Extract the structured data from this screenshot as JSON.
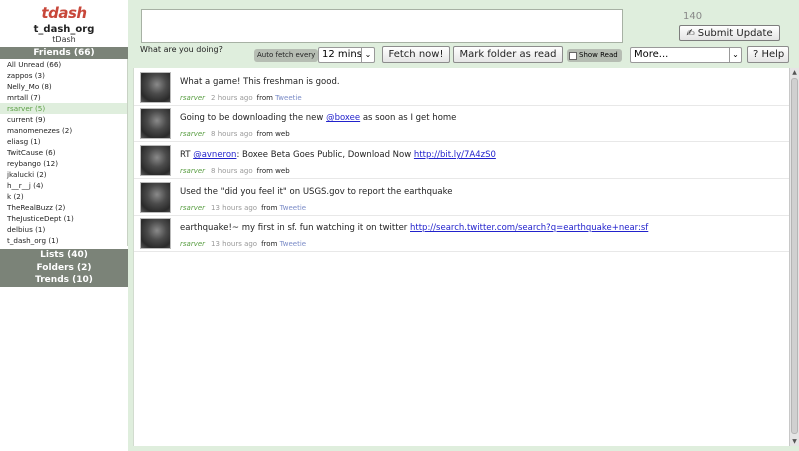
{
  "logo": {
    "t": "t",
    "rest": "dash"
  },
  "user": {
    "username": "t_dash_org",
    "label": "tDash"
  },
  "sidebar": {
    "friends_head": "Friends (66)",
    "friends": [
      {
        "label": "All Unread (66)"
      },
      {
        "label": "zappos (3)"
      },
      {
        "label": "Nelly_Mo (8)"
      },
      {
        "label": "mrtall (7)"
      },
      {
        "label": "rsarver (5)",
        "active": true
      },
      {
        "label": "current (9)"
      },
      {
        "label": "manomenezes (2)"
      },
      {
        "label": "eliasg (1)"
      },
      {
        "label": "TwitCause (6)"
      },
      {
        "label": "reybango (12)"
      },
      {
        "label": "jkalucki (2)"
      },
      {
        "label": "h__r__j (4)"
      },
      {
        "label": "k (2)"
      },
      {
        "label": "TheRealBuzz (2)"
      },
      {
        "label": "TheJusticeDept (1)"
      },
      {
        "label": "delbius (1)"
      },
      {
        "label": "t_dash_org (1)"
      }
    ],
    "lists_head": "Lists (40)",
    "folders_head": "Folders (2)",
    "trends_head": "Trends (10)"
  },
  "compose": {
    "value": "",
    "char_count": "140",
    "submit_label": "Submit Update",
    "prompt": "What are you doing?"
  },
  "toolbar": {
    "autofetch_label": "Auto fetch every",
    "interval_value": "12 mins",
    "fetch_label": "Fetch now!",
    "markread_label": "Mark folder as read",
    "showread_label": "Show Read",
    "more_value": "More...",
    "help_label": "? Help"
  },
  "tweets": [
    {
      "text_before": "What a game! This freshman is good.",
      "mention": "",
      "text_after": "",
      "link": "",
      "author": "rsarver",
      "time": "2 hours ago",
      "from": "from",
      "source": "Tweetie"
    },
    {
      "text_before": "Going to be downloading the new ",
      "mention": "@boxee",
      "text_after": " as soon as I get home",
      "link": "",
      "author": "rsarver",
      "time": "8 hours ago",
      "from": "from",
      "source": "web"
    },
    {
      "text_before": "RT ",
      "mention": "@avneron",
      "text_after": ": Boxee Beta Goes Public, Download Now ",
      "link": "http://bit.ly/7A4zS0",
      "author": "rsarver",
      "time": "8 hours ago",
      "from": "from",
      "source": "web"
    },
    {
      "text_before": "Used the \"did you feel it\" on USGS.gov to report the earthquake",
      "mention": "",
      "text_after": "",
      "link": "",
      "author": "rsarver",
      "time": "13 hours ago",
      "from": "from",
      "source": "Tweetie"
    },
    {
      "text_before": "earthquake!~ my first in sf. fun watching it on twitter ",
      "mention": "",
      "text_after": "",
      "link": "http://search.twitter.com/search?q=earthquake+near:sf",
      "author": "rsarver",
      "time": "13 hours ago",
      "from": "from",
      "source": "Tweetie"
    }
  ],
  "colors": {
    "accent_green": "#5a9e43",
    "panel_bg": "#dfeedd",
    "section_head_bg": "#7b8378",
    "logo_red": "#c8473a",
    "link_blue": "#2222cc"
  },
  "icons": {
    "submit": "pencil-icon",
    "scroll_up": "arrow-up-icon",
    "scroll_down": "arrow-down-icon"
  }
}
